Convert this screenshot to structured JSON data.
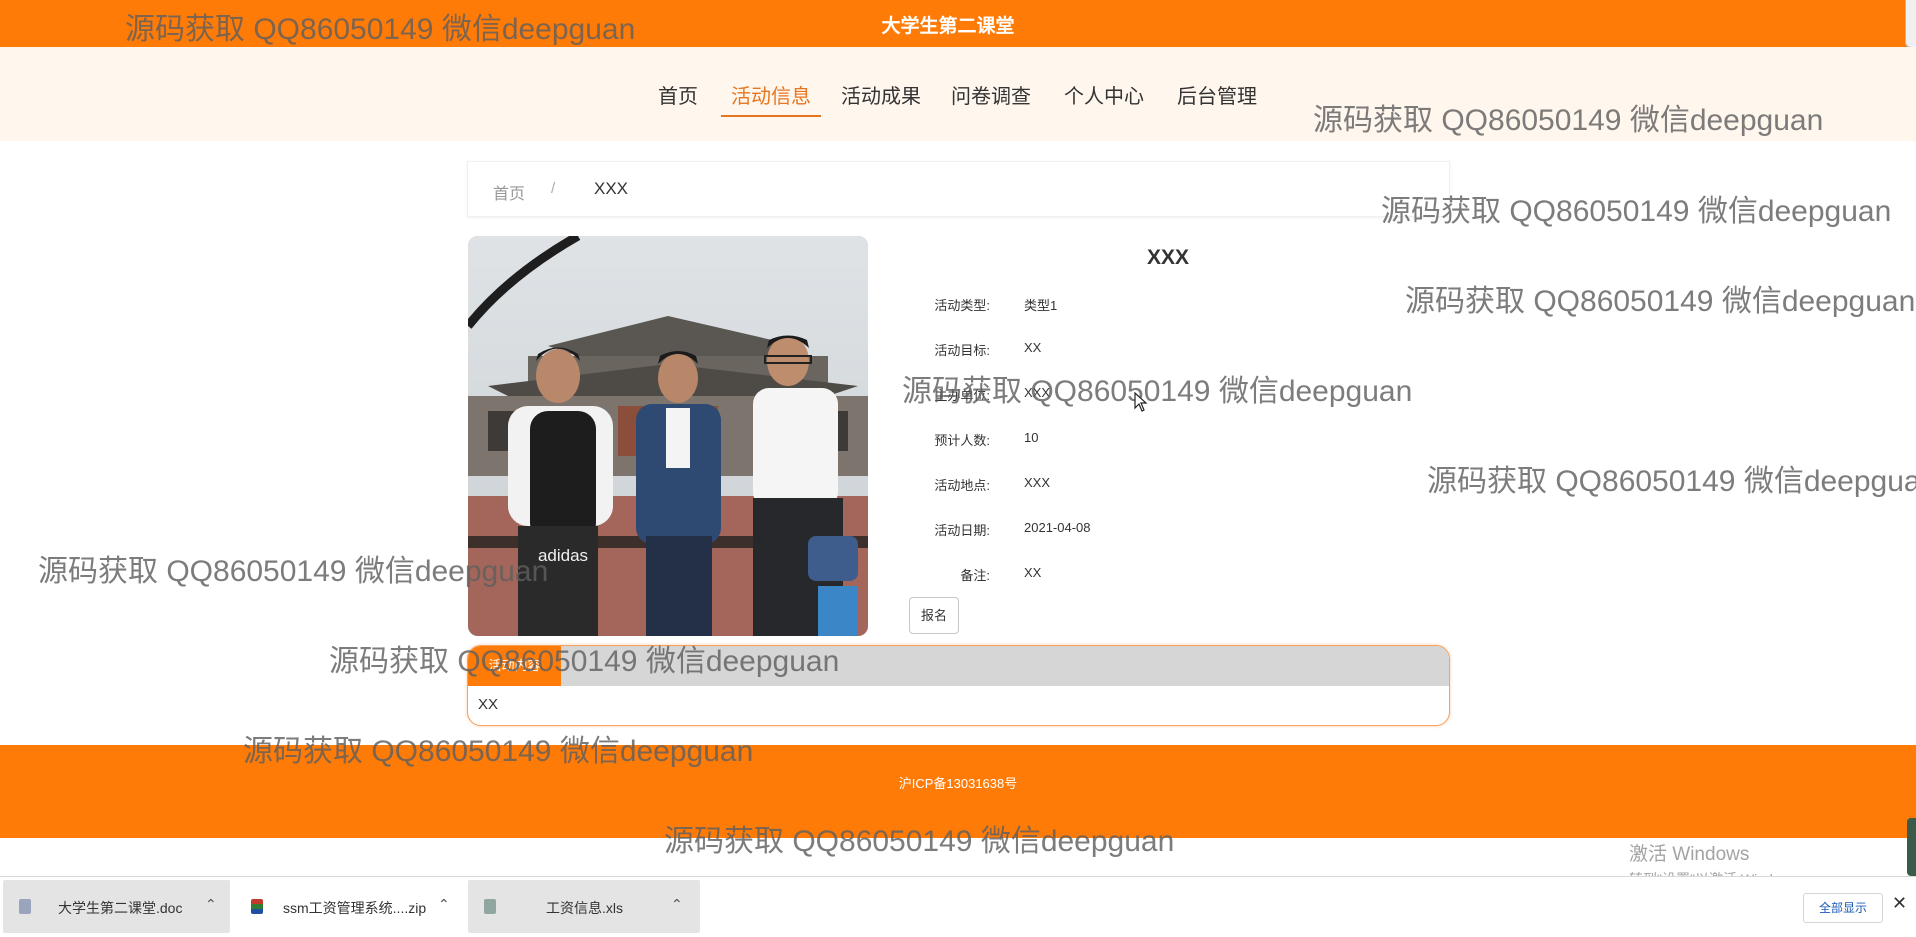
{
  "header": {
    "title": "大学生第二课堂"
  },
  "nav": {
    "items": [
      {
        "label": "首页"
      },
      {
        "label": "活动信息"
      },
      {
        "label": "活动成果"
      },
      {
        "label": "问卷调查"
      },
      {
        "label": "个人中心"
      },
      {
        "label": "后台管理"
      }
    ],
    "active_index": 1
  },
  "breadcrumb": {
    "home": "首页",
    "separator": "/",
    "current": "XXX"
  },
  "detail": {
    "title": "XXX",
    "fields": [
      {
        "label": "活动类型:",
        "value": "类型1"
      },
      {
        "label": "活动目标:",
        "value": "XX"
      },
      {
        "label": "主办单位:",
        "value": "XXX"
      },
      {
        "label": "预计人数:",
        "value": "10"
      },
      {
        "label": "活动地点:",
        "value": "XXX"
      },
      {
        "label": "活动日期:",
        "value": "2021-04-08"
      },
      {
        "label": "备注:",
        "value": "XX"
      }
    ],
    "signup_label": "报名"
  },
  "content": {
    "tab_label": "活动内容",
    "text": "XX"
  },
  "footer": {
    "icp": "沪ICP备13031638号"
  },
  "watermark_text": "源码获取 QQ86050149 微信deepguan",
  "os_notice": {
    "line1": "激活 Windows",
    "line2": "转到\"设置\"以激活 Windows。"
  },
  "downloads": {
    "items": [
      {
        "name": "大学生第二课堂.doc",
        "icon": "word-doc-icon"
      },
      {
        "name": "ssm工资管理系统....zip",
        "icon": "zip-archive-icon"
      },
      {
        "name": "工资信息.xls",
        "icon": "excel-sheet-icon"
      }
    ],
    "show_all_label": "全部显示",
    "close_label": "✕"
  },
  "colors": {
    "brand": "#ff7b08",
    "active_nav": "#e8761e",
    "nav_band": "#fff6ee"
  }
}
